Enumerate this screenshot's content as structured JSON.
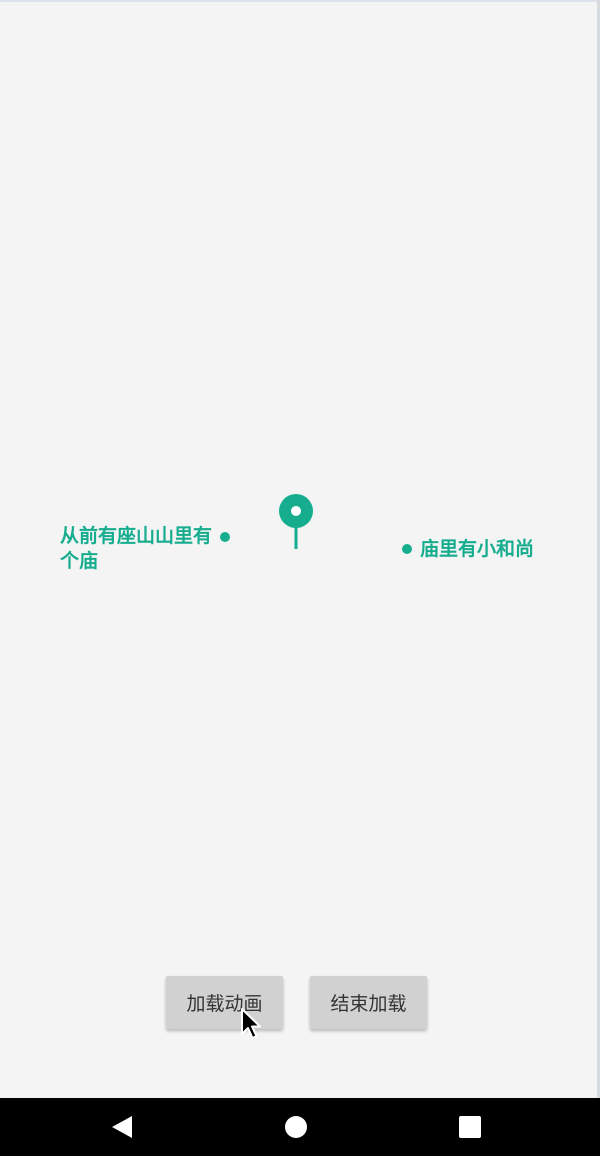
{
  "content": {
    "left_label": "从前有座山山里有个庙",
    "right_label": "庙里有小和尚"
  },
  "buttons": {
    "load_animation": "加载动画",
    "end_loading": "结束加载"
  },
  "colors": {
    "accent": "#16ad8f",
    "background": "#f4f4f4",
    "button_bg": "#d1d1d1",
    "button_text": "#333333",
    "navbar_bg": "#000000"
  },
  "icons": {
    "marker": "map-pin-icon",
    "nav_back": "back-triangle-icon",
    "nav_home": "home-circle-icon",
    "nav_recent": "recent-square-icon",
    "cursor": "mouse-pointer-icon"
  }
}
